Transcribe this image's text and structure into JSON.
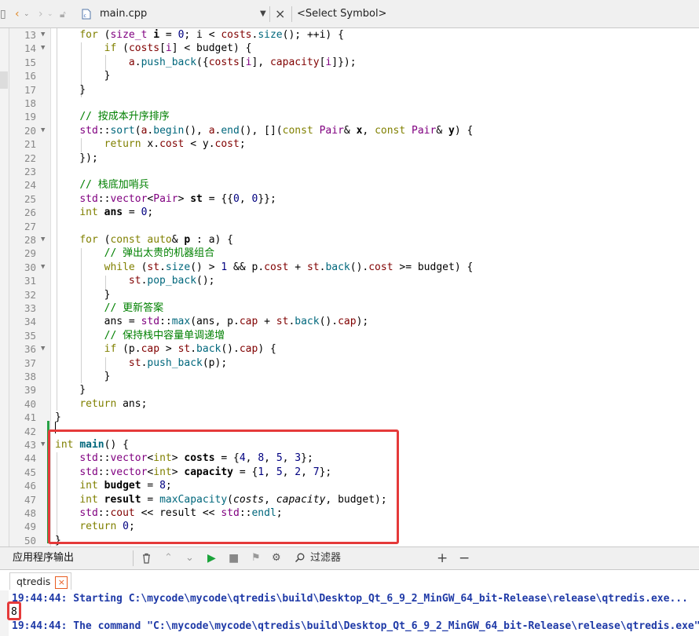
{
  "toolbar": {
    "file_name": "main.cpp",
    "symbol_placeholder": "<Select Symbol>"
  },
  "editor": {
    "lines": [
      {
        "n": "13",
        "fold": true,
        "html": "    <span class='kw'>for</span> (<span class='ty'>size_t</span> <span class='bold'>i</span> = <span class='nm'>0</span>; i &lt; <span class='mem'>costs</span>.<span class='fn'>size</span>(); ++i) {"
      },
      {
        "n": "14",
        "fold": true,
        "html": "        <span class='kw'>if</span> (<span class='mem'>costs</span>[<span class='ty'>i</span>] &lt; budget) {"
      },
      {
        "n": "15",
        "fold": false,
        "html": "            <span class='mem'>a</span>.<span class='fn'>push_back</span>({<span class='mem'>costs</span>[<span class='ty'>i</span>], <span class='mem'>capacity</span>[<span class='ty'>i</span>]});"
      },
      {
        "n": "16",
        "fold": false,
        "html": "        }"
      },
      {
        "n": "17",
        "fold": false,
        "html": "    }"
      },
      {
        "n": "18",
        "fold": false,
        "html": ""
      },
      {
        "n": "19",
        "fold": false,
        "html": "    <span class='cm'>// 按成本升序排序</span>"
      },
      {
        "n": "20",
        "fold": true,
        "html": "    <span class='ty'>std</span>::<span class='fn'>sort</span>(<span class='mem'>a</span>.<span class='fn'>begin</span>(), <span class='mem'>a</span>.<span class='fn'>end</span>(), [](<span class='kw'>const</span> <span class='ty'>Pair</span>&amp; <span class='bold'>x</span>, <span class='kw'>const</span> <span class='ty'>Pair</span>&amp; <span class='bold'>y</span>) {"
      },
      {
        "n": "21",
        "fold": false,
        "html": "        <span class='kw'>return</span> x.<span class='mem'>cost</span> &lt; y.<span class='mem'>cost</span>;"
      },
      {
        "n": "22",
        "fold": false,
        "html": "    });"
      },
      {
        "n": "23",
        "fold": false,
        "html": ""
      },
      {
        "n": "24",
        "fold": false,
        "html": "    <span class='cm'>// 栈底加哨兵</span>"
      },
      {
        "n": "25",
        "fold": false,
        "html": "    <span class='ty'>std</span>::<span class='ty'>vector</span>&lt;<span class='ty'>Pair</span>&gt; <span class='bold'>st</span> = {{<span class='nm'>0</span>, <span class='nm'>0</span>}};"
      },
      {
        "n": "26",
        "fold": false,
        "html": "    <span class='kw'>int</span> <span class='bold'>ans</span> = <span class='nm'>0</span>;"
      },
      {
        "n": "27",
        "fold": false,
        "html": ""
      },
      {
        "n": "28",
        "fold": true,
        "html": "    <span class='kw'>for</span> (<span class='kw'>const</span> <span class='kw'>auto</span>&amp; <span class='bold'>p</span> : a) {"
      },
      {
        "n": "29",
        "fold": false,
        "html": "        <span class='cm'>// 弹出太贵的机器组合</span>"
      },
      {
        "n": "30",
        "fold": true,
        "html": "        <span class='kw'>while</span> (<span class='mem'>st</span>.<span class='fn'>size</span>() &gt; <span class='nm'>1</span> &amp;&amp; p.<span class='mem'>cost</span> + <span class='mem'>st</span>.<span class='fn'>back</span>().<span class='mem'>cost</span> &gt;= budget) {"
      },
      {
        "n": "31",
        "fold": false,
        "html": "            <span class='mem'>st</span>.<span class='fn'>pop_back</span>();"
      },
      {
        "n": "32",
        "fold": false,
        "html": "        }"
      },
      {
        "n": "33",
        "fold": false,
        "html": "        <span class='cm'>// 更新答案</span>"
      },
      {
        "n": "34",
        "fold": false,
        "html": "        ans = <span class='ty'>std</span>::<span class='fn'>max</span>(ans, p.<span class='mem'>cap</span> + <span class='mem'>st</span>.<span class='fn'>back</span>().<span class='mem'>cap</span>);"
      },
      {
        "n": "35",
        "fold": false,
        "html": "        <span class='cm'>// 保持栈中容量单调递增</span>"
      },
      {
        "n": "36",
        "fold": true,
        "html": "        <span class='kw'>if</span> (p.<span class='mem'>cap</span> &gt; <span class='mem'>st</span>.<span class='fn'>back</span>().<span class='mem'>cap</span>) {"
      },
      {
        "n": "37",
        "fold": false,
        "html": "            <span class='mem'>st</span>.<span class='fn'>push_back</span>(p);"
      },
      {
        "n": "38",
        "fold": false,
        "html": "        }"
      },
      {
        "n": "39",
        "fold": false,
        "html": "    }"
      },
      {
        "n": "40",
        "fold": false,
        "html": "    <span class='kw'>return</span> ans;"
      },
      {
        "n": "41",
        "fold": false,
        "html": "}"
      },
      {
        "n": "42",
        "fold": false,
        "html": ""
      },
      {
        "n": "43",
        "fold": true,
        "html": "<span class='kw'>int</span> <span class='fn bold'>main</span>() {"
      },
      {
        "n": "44",
        "fold": false,
        "html": "    <span class='ty'>std</span>::<span class='ty'>vector</span>&lt;<span class='kw'>int</span>&gt; <span class='bold'>costs</span> = {<span class='nm'>4</span>, <span class='nm'>8</span>, <span class='nm'>5</span>, <span class='nm'>3</span>};"
      },
      {
        "n": "45",
        "fold": false,
        "html": "    <span class='ty'>std</span>::<span class='ty'>vector</span>&lt;<span class='kw'>int</span>&gt; <span class='bold'>capacity</span> = {<span class='nm'>1</span>, <span class='nm'>5</span>, <span class='nm'>2</span>, <span class='nm'>7</span>};"
      },
      {
        "n": "46",
        "fold": false,
        "html": "    <span class='kw'>int</span> <span class='bold'>budget</span> = <span class='nm'>8</span>;"
      },
      {
        "n": "47",
        "fold": false,
        "html": "    <span class='kw'>int</span> <span class='bold'>result</span> = <span class='fn'>maxCapacity</span>(<span class='ital'>costs</span>, <span class='ital'>capacity</span>, budget);"
      },
      {
        "n": "48",
        "fold": false,
        "html": "    <span class='ty'>std</span>::<span class='mem'>cout</span> &lt;&lt; result &lt;&lt; <span class='ty'>std</span>::<span class='fn'>endl</span>;"
      },
      {
        "n": "49",
        "fold": false,
        "html": "    <span class='kw'>return</span> <span class='nm'>0</span>;"
      },
      {
        "n": "50",
        "fold": false,
        "html": "}"
      }
    ]
  },
  "output_panel": {
    "title": "应用程序输出",
    "filter_label": "过滤器",
    "plus_label": "+",
    "minus_label": "−",
    "tab_label": "qtredis",
    "tab_close": "×",
    "lines": [
      "19:44:44: Starting C:\\mycode\\mycode\\qtredis\\build\\Desktop_Qt_6_9_2_MinGW_64_bit-Release\\release\\qtredis.exe...",
      "8",
      "19:44:44: The command \"C:\\mycode\\mycode\\qtredis\\build\\Desktop_Qt_6_9_2_MinGW_64_bit-Release\\release\\qtredis.exe\""
    ]
  }
}
